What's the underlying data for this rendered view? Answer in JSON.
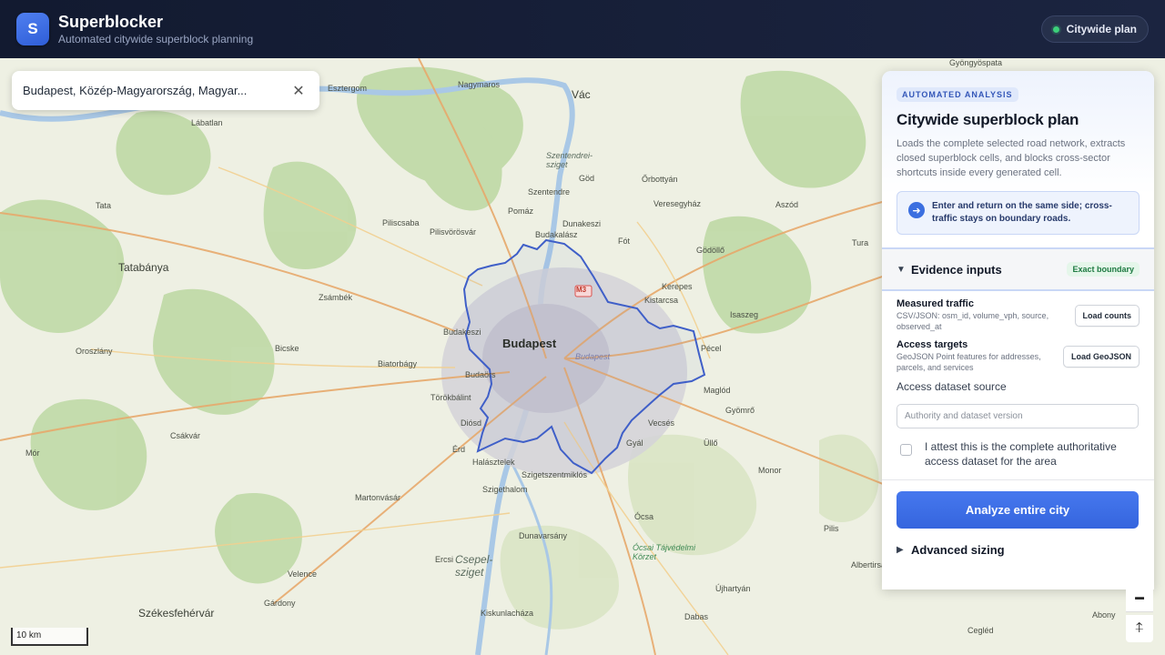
{
  "header": {
    "logo_letter": "S",
    "title": "Superblocker",
    "subtitle": "Automated citywide superblock planning",
    "status_pill": "Citywide plan",
    "status_color": "#3ccf7a"
  },
  "search": {
    "value": "Budapest, Közép-Magyarország, Magyar...",
    "clear_icon": "close-icon"
  },
  "map": {
    "city_label": "Budapest",
    "road_badge": "M3",
    "boundary_color": "#3f5fc8",
    "labels": [
      {
        "text": "Esztergom",
        "kind": "town"
      },
      {
        "text": "Nagymaros",
        "kind": "town"
      },
      {
        "text": "Vác",
        "kind": "big"
      },
      {
        "text": "Gyöngyöspata",
        "kind": "town"
      },
      {
        "text": "Lábatlan",
        "kind": "town"
      },
      {
        "text": "Szentendrei-sziget",
        "kind": "italic"
      },
      {
        "text": "Göd",
        "kind": "town"
      },
      {
        "text": "Őrbottyán",
        "kind": "town"
      },
      {
        "text": "Szentendre",
        "kind": "town"
      },
      {
        "text": "Veresegyház",
        "kind": "town"
      },
      {
        "text": "Aszód",
        "kind": "town"
      },
      {
        "text": "Tata",
        "kind": "town"
      },
      {
        "text": "Piliscsaba",
        "kind": "town"
      },
      {
        "text": "Pilisvörösvár",
        "kind": "town"
      },
      {
        "text": "Pomáz",
        "kind": "town"
      },
      {
        "text": "Dunakeszi",
        "kind": "town"
      },
      {
        "text": "Budakalász",
        "kind": "town"
      },
      {
        "text": "Fót",
        "kind": "town"
      },
      {
        "text": "Gödöllő",
        "kind": "town"
      },
      {
        "text": "Tura",
        "kind": "town"
      },
      {
        "text": "Tatabánya",
        "kind": "big"
      },
      {
        "text": "Zsámbék",
        "kind": "town"
      },
      {
        "text": "Kerepes",
        "kind": "town"
      },
      {
        "text": "Kistarcsa",
        "kind": "town"
      },
      {
        "text": "Isaszeg",
        "kind": "town"
      },
      {
        "text": "Oroszlány",
        "kind": "town"
      },
      {
        "text": "Bicske",
        "kind": "town"
      },
      {
        "text": "Budakeszi",
        "kind": "town"
      },
      {
        "text": "Pécel",
        "kind": "town"
      },
      {
        "text": "Biatorbágy",
        "kind": "town"
      },
      {
        "text": "Budaörs",
        "kind": "town"
      },
      {
        "text": "Maglód",
        "kind": "town"
      },
      {
        "text": "Törökbálint",
        "kind": "town"
      },
      {
        "text": "Gyömrő",
        "kind": "town"
      },
      {
        "text": "Diósd",
        "kind": "town"
      },
      {
        "text": "Vecsés",
        "kind": "town"
      },
      {
        "text": "Csákvár",
        "kind": "town"
      },
      {
        "text": "Érd",
        "kind": "town"
      },
      {
        "text": "Gyál",
        "kind": "town"
      },
      {
        "text": "Üllő",
        "kind": "town"
      },
      {
        "text": "Mór",
        "kind": "town"
      },
      {
        "text": "Halásztelek",
        "kind": "town"
      },
      {
        "text": "Szigetszentmiklós",
        "kind": "town"
      },
      {
        "text": "Monor",
        "kind": "town"
      },
      {
        "text": "Martonvásár",
        "kind": "town"
      },
      {
        "text": "Szigethalom",
        "kind": "town"
      },
      {
        "text": "Ócsa",
        "kind": "town"
      },
      {
        "text": "Pilis",
        "kind": "town"
      },
      {
        "text": "Dunavarsány",
        "kind": "town"
      },
      {
        "text": "Ócsai Tájvédelmi Körzet",
        "kind": "italic"
      },
      {
        "text": "Ercsi",
        "kind": "town"
      },
      {
        "text": "Csepel-sziget",
        "kind": "italic"
      },
      {
        "text": "Velence",
        "kind": "town"
      },
      {
        "text": "Albertirsa",
        "kind": "town"
      },
      {
        "text": "Újhartyán",
        "kind": "town"
      },
      {
        "text": "Székesfehérvár",
        "kind": "big"
      },
      {
        "text": "Gárdony",
        "kind": "town"
      },
      {
        "text": "Kiskunlacháza",
        "kind": "town"
      },
      {
        "text": "Dabas",
        "kind": "town"
      },
      {
        "text": "Abony",
        "kind": "town"
      },
      {
        "text": "Cegléd",
        "kind": "town"
      },
      {
        "text": "Budapest",
        "kind": "italic"
      }
    ],
    "scale_label": "10 km",
    "zoom_out_icon": "minus-icon",
    "north_icon": "compass-arrow-icon"
  },
  "panel": {
    "badge": "AUTOMATED ANALYSIS",
    "title": "Citywide superblock plan",
    "description": "Loads the complete selected road network, extracts closed superblock cells, and blocks cross-sector shortcuts inside every generated cell.",
    "callout": "Enter and return on the same side; cross-traffic stays on boundary roads.",
    "callout_icon": "arrow-right-icon",
    "evidence": {
      "caret": "▼",
      "title": "Evidence inputs",
      "badge": "Exact boundary",
      "badge_color": "#1e7a42",
      "measured": {
        "title": "Measured traffic",
        "desc": "CSV/JSON: osm_id, volume_vph, source, observed_at",
        "button": "Load counts"
      },
      "access": {
        "title": "Access targets",
        "desc": "GeoJSON Point features for addresses, parcels, and services",
        "button": "Load GeoJSON"
      },
      "source_label": "Access dataset source",
      "source_placeholder": "Authority and dataset version",
      "attest": "I attest this is the complete authoritative access dataset for the area"
    },
    "analyze_button": "Analyze entire city",
    "accent_color": "#3b6fe0",
    "advanced": {
      "caret": "▶",
      "title": "Advanced sizing"
    }
  }
}
